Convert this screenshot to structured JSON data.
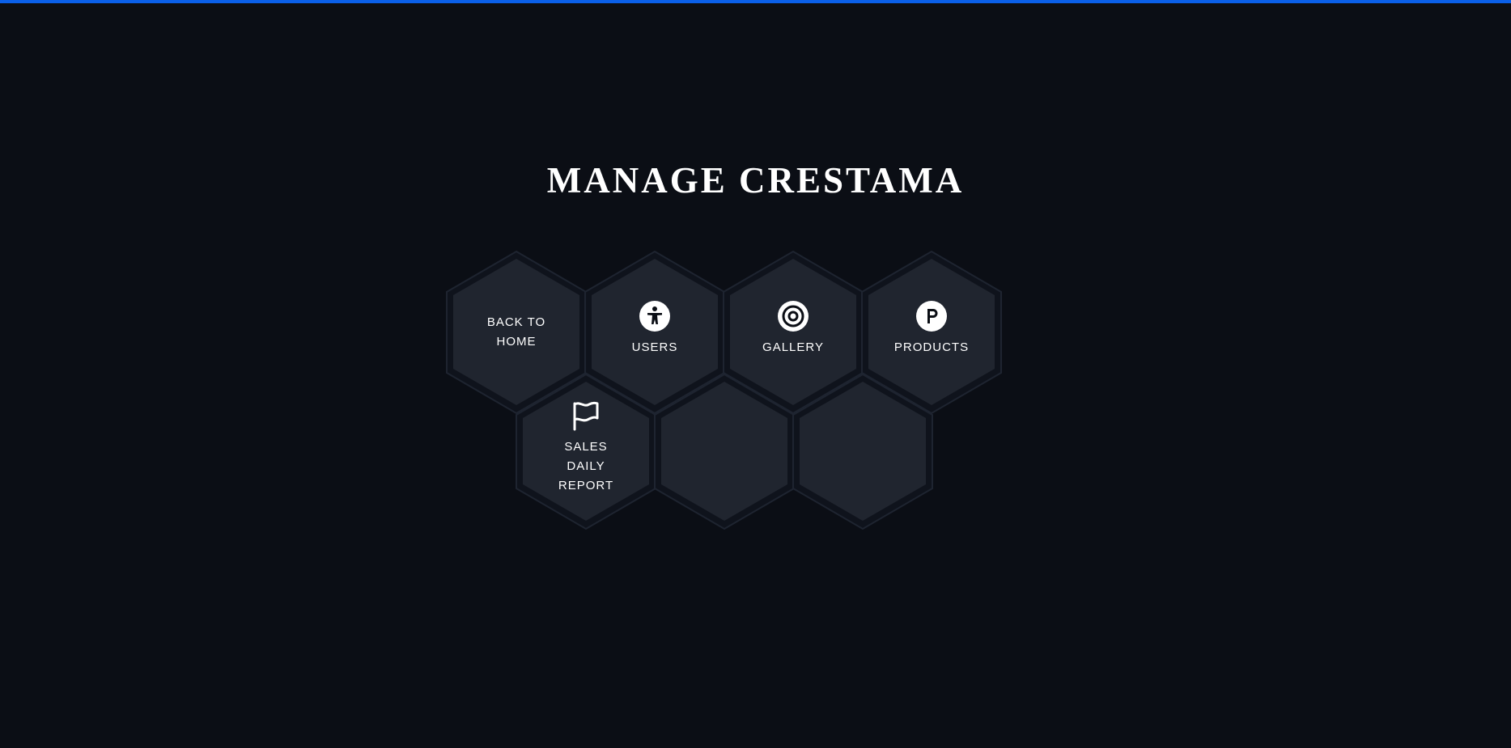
{
  "page": {
    "title": "MANAGE CRESTAMA",
    "accent_color": "#0a5fe8",
    "background_color": "#0b0e15"
  },
  "menu": {
    "back_home": {
      "label": "BACK TO HOME"
    },
    "users": {
      "label": "USERS",
      "icon": "accessibility-icon"
    },
    "gallery": {
      "label": "GALLERY",
      "icon": "target-icon"
    },
    "products": {
      "label": "PRODUCTS",
      "icon": "parking-icon"
    },
    "sales_daily_report": {
      "label": "SALES DAILY REPORT",
      "icon": "flag-icon"
    }
  }
}
